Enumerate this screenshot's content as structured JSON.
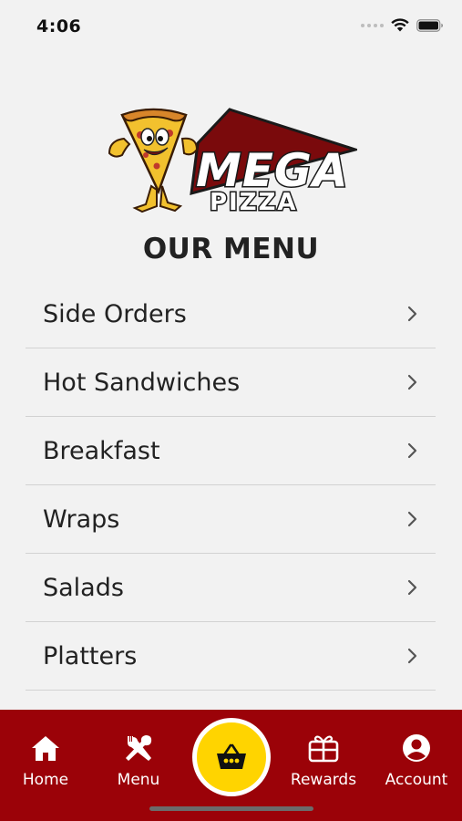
{
  "status_bar": {
    "time": "4:06",
    "icons": [
      "signal-dots-icon",
      "wifi-icon",
      "battery-icon"
    ]
  },
  "logo": {
    "brand_top": "MEGA",
    "brand_bottom": "PIZZA",
    "mascot": "pizza-slice-mascot"
  },
  "page": {
    "title": "OUR MENU"
  },
  "menu": {
    "items": [
      {
        "label": "Side Orders"
      },
      {
        "label": "Hot Sandwiches"
      },
      {
        "label": "Breakfast"
      },
      {
        "label": "Wraps"
      },
      {
        "label": "Salads"
      },
      {
        "label": "Platters"
      }
    ]
  },
  "bottom_nav": {
    "home_label": "Home",
    "menu_label": "Menu",
    "rewards_label": "Rewards",
    "account_label": "Account",
    "cart_icon": "basket-icon"
  },
  "colors": {
    "nav_background": "#9b0208",
    "cart_button": "#ffd400",
    "page_background": "#f2f2f2"
  }
}
